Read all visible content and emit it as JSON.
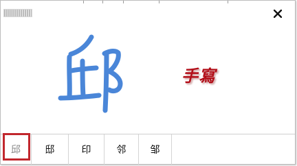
{
  "window": {
    "close_icon": "close-icon",
    "drag_handle_icon": "grip-icon"
  },
  "handwriting": {
    "watermark_text": "手寫",
    "stroke_color": "#4a86d8",
    "watermark_color": "#b3101a"
  },
  "candidates": [
    {
      "char": "邱",
      "selected": true
    },
    {
      "char": "邸",
      "selected": false
    },
    {
      "char": "印",
      "selected": false
    },
    {
      "char": "邻",
      "selected": false
    },
    {
      "char": "邹",
      "selected": false
    }
  ],
  "selection_color": "#c1272d"
}
